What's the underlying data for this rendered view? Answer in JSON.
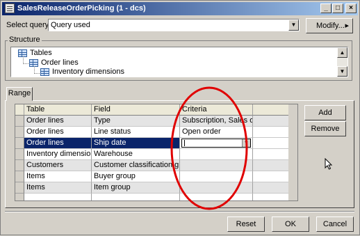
{
  "window": {
    "title": "SalesReleaseOrderPicking (1 - dcs)",
    "controls": {
      "minimize": "_",
      "maximize": "□",
      "close": "×"
    }
  },
  "query": {
    "label": "Select query:",
    "value": "Query used",
    "modify_label": "Modify...",
    "modify_arrow": "▸"
  },
  "structure": {
    "label": "Structure",
    "nodes": [
      {
        "label": "Tables"
      },
      {
        "label": "Order lines"
      },
      {
        "label": "Inventory dimensions"
      }
    ]
  },
  "range": {
    "tab_label": "Range",
    "columns": [
      "Table",
      "Field",
      "Criteria"
    ],
    "rows": [
      {
        "table": "Order lines",
        "field": "Type",
        "criteria": "Subscription, Sales or..."
      },
      {
        "table": "Order lines",
        "field": "Line status",
        "criteria": "Open order"
      },
      {
        "table": "Order lines",
        "field": "Ship date",
        "criteria": ""
      },
      {
        "table": "Inventory dimensions",
        "field": "Warehouse",
        "criteria": ""
      },
      {
        "table": "Customers",
        "field": "Customer classification group",
        "criteria": ""
      },
      {
        "table": "Items",
        "field": "Buyer group",
        "criteria": ""
      },
      {
        "table": "Items",
        "field": "Item group",
        "criteria": ""
      }
    ],
    "selected_row": 3,
    "add_label": "Add",
    "remove_label": "Remove"
  },
  "footer": {
    "reset_label": "Reset",
    "ok_label": "OK",
    "cancel_label": "Cancel"
  },
  "colors": {
    "title_start": "#0a246a",
    "title_end": "#a6caf0",
    "selection": "#0a246a",
    "annotation_oval": "#e00000",
    "dialog_bg": "#d4d0c8"
  },
  "icons": [
    "app-icon",
    "chevron-down-icon",
    "arrow-right-icon",
    "table-icon",
    "mouse-pointer-icon"
  ]
}
